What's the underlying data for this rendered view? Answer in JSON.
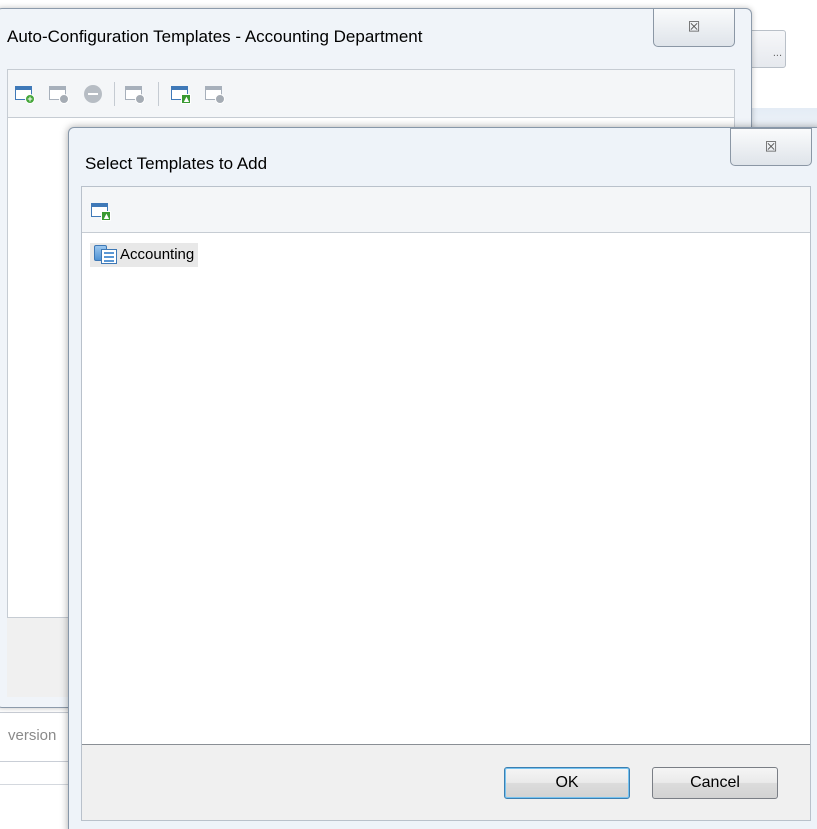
{
  "background": {
    "top_button_label": "...",
    "bottom_text": "version"
  },
  "parent_window": {
    "title": "Auto-Configuration Templates - Accounting Department",
    "close_glyph": "☒",
    "toolbar": {
      "icons": [
        "new-template-icon",
        "edit-template-icon",
        "remove-icon",
        "properties-icon",
        "add-from-templates-icon",
        "export-icon"
      ]
    }
  },
  "dialog": {
    "title": "Select Templates to Add",
    "close_glyph": "☒",
    "toolbar": {
      "icons": [
        "add-from-templates-icon"
      ]
    },
    "items": [
      {
        "label": "Accounting",
        "icon": "group-template-icon"
      }
    ],
    "buttons": {
      "ok": "OK",
      "cancel": "Cancel"
    }
  }
}
